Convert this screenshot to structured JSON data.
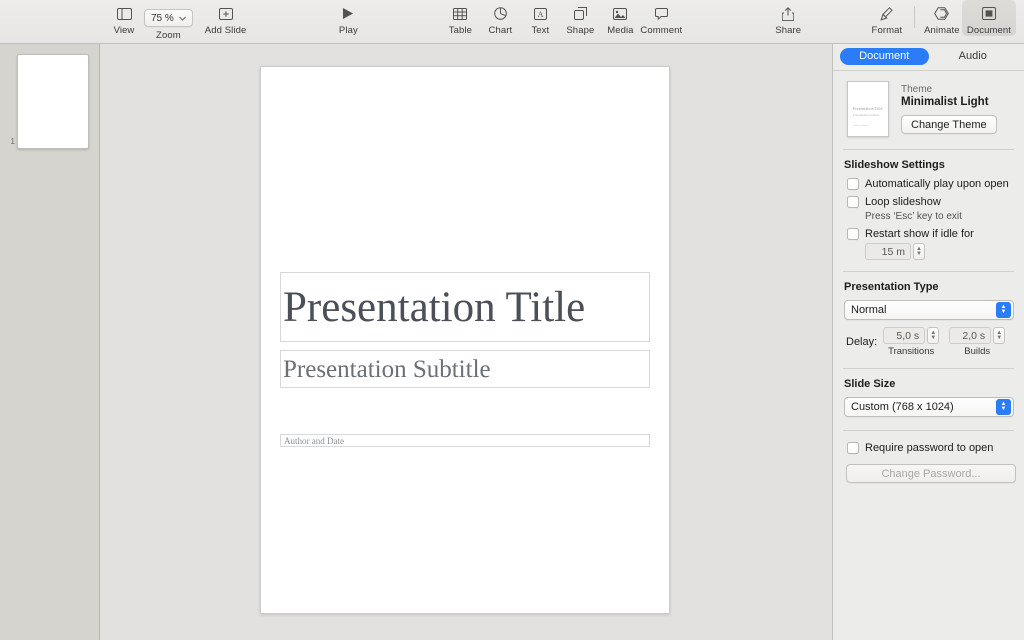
{
  "toolbar": {
    "left_items": [
      {
        "label": "View",
        "icon": "sidebar-panel-icon"
      },
      {
        "label": "Zoom",
        "icon": "zoom-dropdown-icon",
        "value": "75 %"
      },
      {
        "label": "Add Slide",
        "icon": "add-slide-icon"
      }
    ],
    "play": {
      "label": "Play",
      "icon": "play-icon"
    },
    "insert_items": [
      {
        "label": "Table",
        "icon": "table-icon"
      },
      {
        "label": "Chart",
        "icon": "chart-icon"
      },
      {
        "label": "Text",
        "icon": "text-icon"
      },
      {
        "label": "Shape",
        "icon": "shape-icon"
      },
      {
        "label": "Media",
        "icon": "media-icon"
      },
      {
        "label": "Comment",
        "icon": "comment-icon"
      }
    ],
    "share": {
      "label": "Share",
      "icon": "share-icon"
    },
    "right_items": [
      {
        "label": "Format",
        "icon": "format-brush-icon"
      },
      {
        "label": "Animate",
        "icon": "animate-diamond-icon"
      },
      {
        "label": "Document",
        "icon": "document-icon"
      }
    ]
  },
  "navigator": {
    "slides": [
      {
        "number": "1"
      }
    ]
  },
  "slide": {
    "title": "Presentation Title",
    "subtitle": "Presentation Subtitle",
    "author": "Author and Date"
  },
  "inspector": {
    "tabs": [
      {
        "label": "Document",
        "active": true
      },
      {
        "label": "Audio",
        "active": false
      }
    ],
    "theme": {
      "kicker": "Theme",
      "name": "Minimalist Light",
      "change_button": "Change Theme",
      "preview": {
        "title": "Presentation Title",
        "subtitle": "Presentation Subtitle",
        "author": "Author and Date"
      }
    },
    "slideshow": {
      "section_title": "Slideshow Settings",
      "auto_play": "Automatically play upon open",
      "loop": "Loop slideshow",
      "loop_hint": "Press ‘Esc’ key to exit",
      "restart": "Restart show if idle for",
      "restart_value": "15 m"
    },
    "presentation_type": {
      "section_title": "Presentation Type",
      "selected": "Normal",
      "delay_label": "Delay:",
      "transitions_value": "5,0 s",
      "transitions_caption": "Transitions",
      "builds_value": "2,0 s",
      "builds_caption": "Builds"
    },
    "slide_size": {
      "section_title": "Slide Size",
      "selected": "Custom (768 x 1024)"
    },
    "password": {
      "require_label": "Require password to open",
      "change_button": "Change Password..."
    }
  },
  "colors": {
    "accent": "#2a7cf7",
    "toolbar_bg": "#eae9e7",
    "canvas_bg": "#e2e1df",
    "navigator_bg": "#d6d4cf",
    "inspector_bg": "#ececea"
  }
}
